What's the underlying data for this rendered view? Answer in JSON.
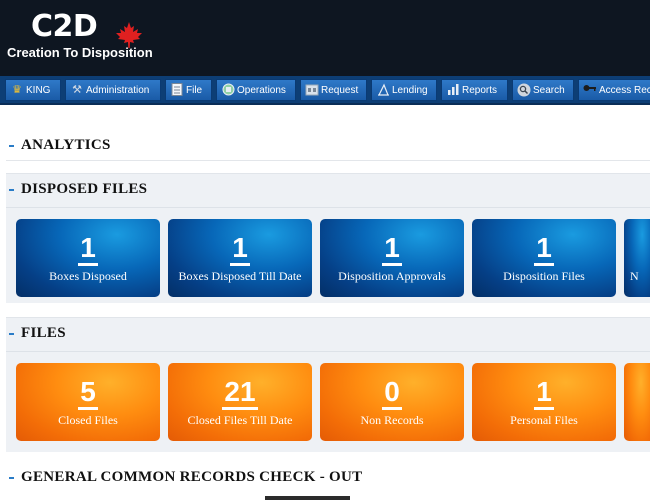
{
  "header": {
    "logo_title": "C2D",
    "logo_subtitle": "Creation To Disposition"
  },
  "nav": {
    "items": [
      {
        "label": "KING",
        "icon": "crown-icon"
      },
      {
        "label": "Administration",
        "icon": "wrench-icon"
      },
      {
        "label": "File",
        "icon": "document-icon"
      },
      {
        "label": "Operations",
        "icon": "operations-icon"
      },
      {
        "label": "Request",
        "icon": "request-icon"
      },
      {
        "label": "Lending",
        "icon": "lending-icon"
      },
      {
        "label": "Reports",
        "icon": "reports-icon"
      },
      {
        "label": "Search",
        "icon": "search-icon"
      },
      {
        "label": "Access Rec",
        "icon": "key-icon"
      }
    ]
  },
  "analytics": {
    "title": "ANALYTICS"
  },
  "disposed_files": {
    "title": "DISPOSED FILES",
    "tiles": [
      {
        "value": "1",
        "label": "Boxes Disposed"
      },
      {
        "value": "1",
        "label": "Boxes Disposed Till Date"
      },
      {
        "value": "1",
        "label": "Disposition Approvals"
      },
      {
        "value": "1",
        "label": "Disposition Files"
      },
      {
        "value": "",
        "label": "N"
      }
    ]
  },
  "files": {
    "title": "FILES",
    "tiles": [
      {
        "value": "5",
        "label": "Closed Files"
      },
      {
        "value": "21",
        "label": "Closed Files Till Date"
      },
      {
        "value": "0",
        "label": "Non Records"
      },
      {
        "value": "1",
        "label": "Personal Files"
      },
      {
        "value": "",
        "label": ""
      }
    ]
  },
  "general_checkout": {
    "title": "GENERAL COMMON RECORDS CHECK - OUT"
  },
  "colors": {
    "header_bg": "#0e1621",
    "nav_bg": "#0d3e75",
    "tile_blue": "#0767b8",
    "tile_orange": "#ff8d10",
    "leaf_red": "#e02020"
  }
}
